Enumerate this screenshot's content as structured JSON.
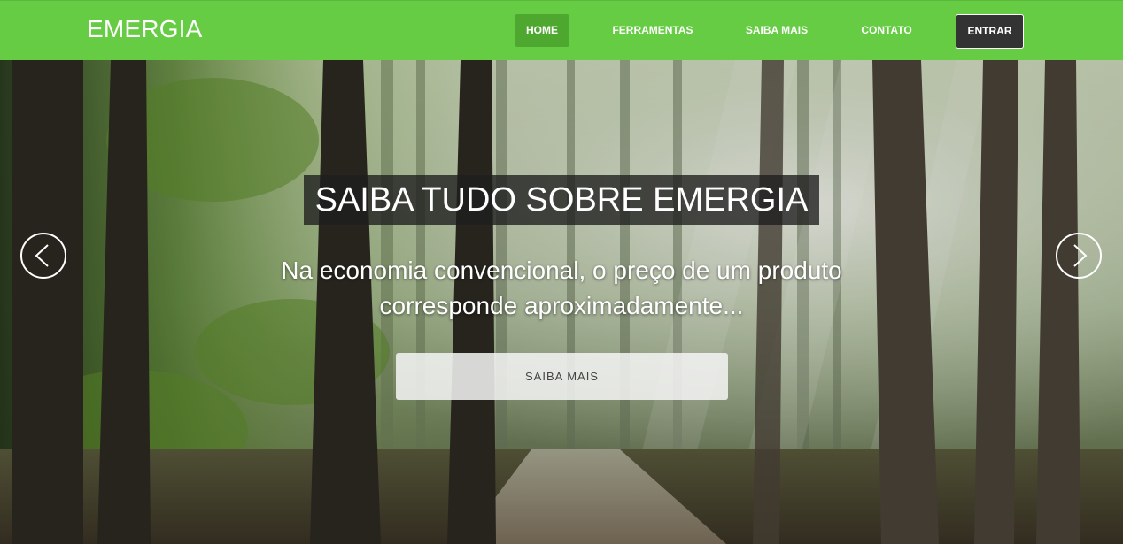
{
  "brand": {
    "name": "EMERGIA"
  },
  "nav": {
    "items": [
      {
        "label": "HOME",
        "active": true
      },
      {
        "label": "FERRAMENTAS"
      },
      {
        "label": "SAIBA MAIS"
      },
      {
        "label": "CONTATO"
      }
    ],
    "login_label": "ENTRAR"
  },
  "hero": {
    "title": "SAIBA TUDO SOBRE EMERGIA",
    "subtitle": "Na economia convencional, o preço de um produto corresponde aproximadamente...",
    "cta_label": "SAIBA MAIS",
    "prev_icon": "chevron-left-icon",
    "next_icon": "chevron-right-icon"
  },
  "colors": {
    "navbar": "#66cc44",
    "nav_active": "#4ea82f",
    "login_button": "#333333"
  }
}
